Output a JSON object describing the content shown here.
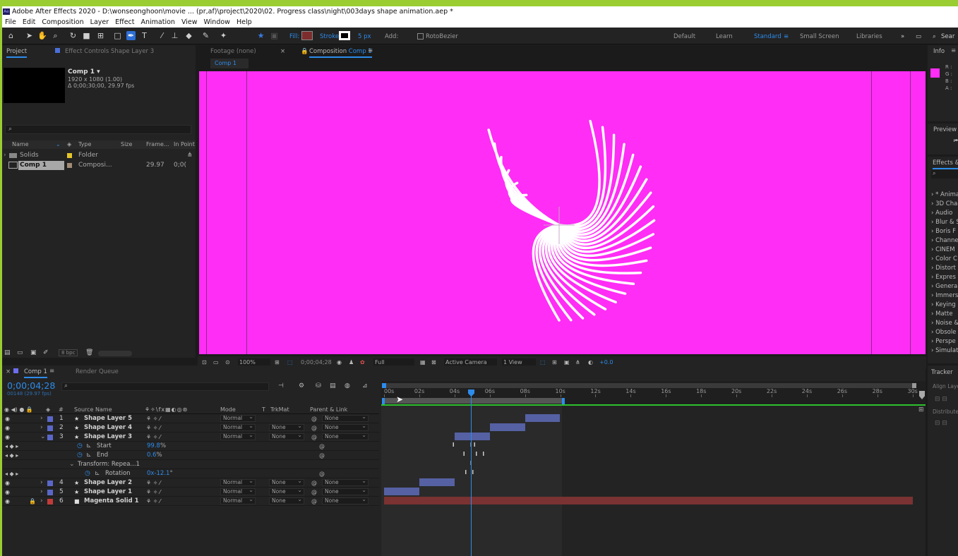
{
  "window": {
    "title": "Adobe After Effects 2020 - D:\\wonseonghoon\\movie ... (pr,af)\\project\\2020\\02. Progress class\\night\\003days shape animation.aep *"
  },
  "menu": [
    "File",
    "Edit",
    "Composition",
    "Layer",
    "Effect",
    "Animation",
    "View",
    "Window",
    "Help"
  ],
  "toolbar": {
    "fill_label": "Fill:",
    "stroke_label": "Stroke:",
    "stroke_width": "5 px",
    "add_label": "Add:",
    "rotobezier": "RotoBezier",
    "workspaces": [
      "Default",
      "Learn",
      "Standard",
      "Small Screen",
      "Libraries"
    ],
    "active_workspace": "Standard",
    "search_placeholder": "Sear"
  },
  "project_panel": {
    "tab": "Project",
    "effect_controls_tab": "Effect Controls Shape Layer 3",
    "comp_name": "Comp 1 ▾",
    "comp_res": "1920 x 1080 (1.00)",
    "comp_duration": "Δ 0;00;30;00, 29.97 fps",
    "search_placeholder": "",
    "columns": [
      "Name",
      "Type",
      "Size",
      "Frame...",
      "In Point"
    ],
    "items": [
      {
        "name": "Solids",
        "type": "Folder",
        "size": "",
        "fps": "",
        "in": ""
      },
      {
        "name": "Comp 1",
        "type": "Composi...",
        "size": "",
        "fps": "29.97",
        "in": "0;0("
      }
    ],
    "bpc": "8 bpc"
  },
  "viewer": {
    "tab_footage": "Footage (none)",
    "tab_composition": "Composition",
    "tab_composition_name": "Comp 1",
    "breadcrumb": "Comp 1",
    "zoom": "100%",
    "timecode": "0;00;04;28",
    "resolution": "Full",
    "camera": "Active Camera",
    "views": "1 View",
    "exposure": "+0.0",
    "bg_color": "#ff2df5"
  },
  "right_panel": {
    "info_tab": "Info",
    "info_channels": [
      "R : ",
      "G : ",
      "B : ",
      "A : "
    ],
    "swatch_color": "#ff2df5",
    "preview_tab": "Preview",
    "effects_tab": "Effects &",
    "effects_search": "",
    "effects_list": [
      "* Anima",
      "3D Cha",
      "Audio",
      "Blur & S",
      "Boris F",
      "Channe",
      "CINEM",
      "Color C",
      "Distort",
      "Expres",
      "Genera",
      "Immers",
      "Keying",
      "Matte",
      "Noise &",
      "Obsole",
      "Perspe",
      "Simulat"
    ],
    "tracker_tab": "Tracker",
    "align_tab": "Align Layer",
    "distribute_tab": "Distribute L"
  },
  "timeline": {
    "tab": "Comp 1",
    "render_queue_tab": "Render Queue",
    "timecode": "0;00;04;28",
    "frame_info": "00148 (29.97 fps)",
    "columns": [
      "Source Name",
      "Mode",
      "T",
      "TrkMat",
      "Parent & Link"
    ],
    "ruler": [
      "00s",
      "02s",
      "04s",
      "06s",
      "08s",
      "10s",
      "12s",
      "14s",
      "16s",
      "18s",
      "20s",
      "22s",
      "24s",
      "26s",
      "28s",
      "30s"
    ],
    "layers": [
      {
        "num": "1",
        "name": "Shape Layer 5",
        "mode": "Normal",
        "trkmat": "",
        "parent": "None",
        "color": "#5a67c8"
      },
      {
        "num": "2",
        "name": "Shape Layer 4",
        "mode": "Normal",
        "trkmat": "None",
        "parent": "None",
        "color": "#5a67c8"
      },
      {
        "num": "3",
        "name": "Shape Layer 3",
        "mode": "Normal",
        "trkmat": "None",
        "parent": "None",
        "color": "#5a67c8"
      },
      {
        "num": "4",
        "name": "Shape Layer 2",
        "mode": "Normal",
        "trkmat": "None",
        "parent": "None",
        "color": "#5a67c8"
      },
      {
        "num": "5",
        "name": "Shape Layer 1",
        "mode": "Normal",
        "trkmat": "None",
        "parent": "None",
        "color": "#5a67c8"
      },
      {
        "num": "6",
        "name": "Magenta Solid 1",
        "mode": "Normal",
        "trkmat": "None",
        "parent": "None",
        "color": "#c23b3b"
      }
    ],
    "props": [
      {
        "name": "Start",
        "value": "99.8",
        "unit": "%"
      },
      {
        "name": "End",
        "value": "0.6",
        "unit": "%"
      },
      {
        "name": "Transform: Repea...1",
        "value": "",
        "unit": ""
      },
      {
        "name": "Rotation",
        "value": "0x-12.1",
        "unit": "°"
      }
    ],
    "playhead_seconds": 4.93
  }
}
